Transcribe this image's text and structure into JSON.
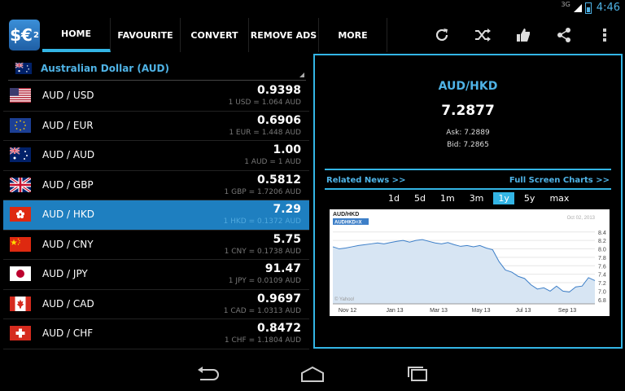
{
  "status": {
    "network": "3G",
    "time": "4:46"
  },
  "app": {
    "icon_text": "$€",
    "icon_sup": "2"
  },
  "tabs": [
    {
      "label": "HOME",
      "active": true
    },
    {
      "label": "FAVOURITE",
      "active": false
    },
    {
      "label": "CONVERT",
      "active": false
    },
    {
      "label": "REMOVE ADS",
      "active": false
    },
    {
      "label": "MORE",
      "active": false
    }
  ],
  "actions": [
    "refresh-icon",
    "shuffle-icon",
    "thumbs-up-icon",
    "share-icon",
    "overflow-menu-icon"
  ],
  "base_currency": {
    "label": "Australian Dollar (AUD)"
  },
  "rates": [
    {
      "flag": "us",
      "pair": "AUD / USD",
      "rate": "0.9398",
      "sub": "1 USD = 1.064 AUD",
      "selected": false
    },
    {
      "flag": "eu",
      "pair": "AUD / EUR",
      "rate": "0.6906",
      "sub": "1 EUR = 1.448 AUD",
      "selected": false
    },
    {
      "flag": "au",
      "pair": "AUD / AUD",
      "rate": "1.00",
      "sub": "1 AUD = 1 AUD",
      "selected": false
    },
    {
      "flag": "gb",
      "pair": "AUD / GBP",
      "rate": "0.5812",
      "sub": "1 GBP = 1.7206 AUD",
      "selected": false
    },
    {
      "flag": "hk",
      "pair": "AUD / HKD",
      "rate": "7.29",
      "sub": "1 HKD = 0.1372 AUD",
      "selected": true
    },
    {
      "flag": "cn",
      "pair": "AUD / CNY",
      "rate": "5.75",
      "sub": "1 CNY = 0.1738 AUD",
      "selected": false
    },
    {
      "flag": "jp",
      "pair": "AUD / JPY",
      "rate": "91.47",
      "sub": "1 JPY = 0.0109 AUD",
      "selected": false
    },
    {
      "flag": "ca",
      "pair": "AUD / CAD",
      "rate": "0.9697",
      "sub": "1 CAD = 1.0313 AUD",
      "selected": false
    },
    {
      "flag": "ch",
      "pair": "AUD / CHF",
      "rate": "0.8472",
      "sub": "1 CHF = 1.1804 AUD",
      "selected": false
    }
  ],
  "detail": {
    "title": "AUD/HKD",
    "rate": "7.2877",
    "ask": "Ask: 7.2889",
    "bid": "Bid: 7.2865",
    "related_news": "Related News >>",
    "full_screen": "Full Screen Charts >>",
    "periods": [
      {
        "label": "1d",
        "active": false
      },
      {
        "label": "5d",
        "active": false
      },
      {
        "label": "1m",
        "active": false
      },
      {
        "label": "3m",
        "active": false
      },
      {
        "label": "1y",
        "active": true
      },
      {
        "label": "5y",
        "active": false
      },
      {
        "label": "max",
        "active": false
      }
    ]
  },
  "chart_data": {
    "type": "area",
    "title": "AUD/HKD",
    "series_label": "AUDHKD=X",
    "date": "Oct 02, 2013",
    "watermark": "© Yahoo!",
    "x_ticks": [
      "Nov 12",
      "Jan 13",
      "Mar 13",
      "May 13",
      "Jul 13",
      "Sep 13"
    ],
    "y_ticks": [
      6.8,
      7.0,
      7.2,
      7.4,
      7.6,
      7.8,
      8.0,
      8.2,
      8.4
    ],
    "ylim": [
      6.7,
      8.55
    ],
    "x": [
      0,
      8,
      16,
      24,
      32,
      40,
      48,
      56,
      64,
      72,
      80,
      88,
      96,
      104,
      112,
      120,
      128,
      136,
      144,
      152,
      160,
      168,
      176,
      184,
      192,
      200,
      208,
      216,
      224,
      232,
      240,
      248,
      256,
      264,
      272,
      280,
      288,
      296,
      304,
      312,
      320,
      328
    ],
    "values": [
      8.05,
      8.0,
      8.02,
      8.05,
      8.08,
      8.1,
      8.12,
      8.14,
      8.12,
      8.15,
      8.18,
      8.2,
      8.16,
      8.2,
      8.22,
      8.18,
      8.14,
      8.12,
      8.15,
      8.1,
      8.06,
      8.08,
      8.05,
      8.08,
      8.02,
      7.98,
      7.7,
      7.5,
      7.45,
      7.35,
      7.3,
      7.15,
      7.05,
      7.08,
      7.0,
      7.12,
      7.0,
      6.98,
      7.1,
      7.12,
      7.32,
      7.25
    ],
    "color": "#3d7fc8",
    "fill": "#d7e5f3"
  },
  "nav": [
    "back-icon",
    "home-icon",
    "recents-icon"
  ]
}
